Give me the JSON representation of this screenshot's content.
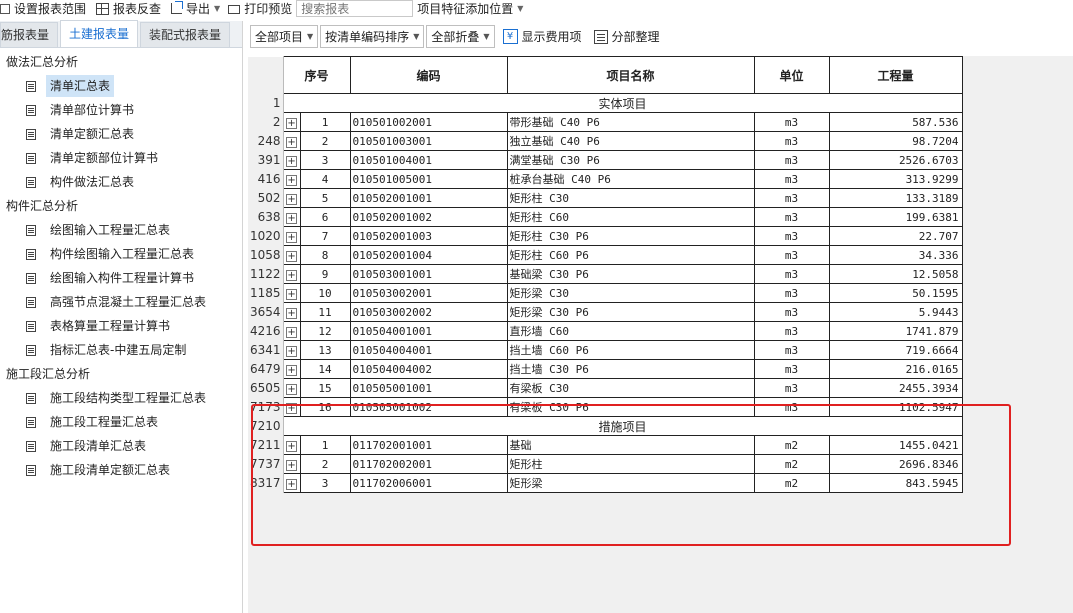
{
  "toolbar": {
    "set_range": "设置报表范围",
    "report_check": "报表反查",
    "export": "导出",
    "print_preview": "打印预览",
    "search_placeholder": "搜索报表",
    "feature_position": "项目特征添加位置"
  },
  "left_tabs": [
    "钢筋报表量",
    "土建报表量",
    "装配式报表量"
  ],
  "left_tabs_display": [
    "筋报表量",
    "土建报表量",
    "装配式报表量"
  ],
  "tree": {
    "group1": "做法汇总分析",
    "group1_items": [
      "清单汇总表",
      "清单部位计算书",
      "清单定额汇总表",
      "清单定额部位计算书",
      "构件做法汇总表"
    ],
    "group2": "构件汇总分析",
    "group2_items": [
      "绘图输入工程量汇总表",
      "构件绘图输入工程量汇总表",
      "绘图输入构件工程量计算书",
      "高强节点混凝土工程量汇总表",
      "表格算量工程量计算书",
      "指标汇总表-中建五局定制"
    ],
    "group3": "施工段汇总分析",
    "group3_items": [
      "施工段结构类型工程量汇总表",
      "施工段工程量汇总表",
      "施工段清单汇总表",
      "施工段清单定额汇总表"
    ]
  },
  "filters": {
    "all_items": "全部项目",
    "sort": "按清单编码排序",
    "fold": "全部折叠",
    "show_fee": "显示费用项",
    "section_sort": "分部整理"
  },
  "grid": {
    "headers": {
      "seq": "序号",
      "code": "编码",
      "name": "项目名称",
      "unit": "单位",
      "qty": "工程量"
    },
    "section1": {
      "row_no": "1",
      "title": "实体项目"
    },
    "rows1": [
      {
        "rn": "2",
        "seq": "1",
        "code": "010501002001",
        "name": "带形基础 C40 P6",
        "unit": "m3",
        "qty": "587.536"
      },
      {
        "rn": "248",
        "seq": "2",
        "code": "010501003001",
        "name": "独立基础 C40 P6",
        "unit": "m3",
        "qty": "98.7204"
      },
      {
        "rn": "391",
        "seq": "3",
        "code": "010501004001",
        "name": "满堂基础 C30 P6",
        "unit": "m3",
        "qty": "2526.6703"
      },
      {
        "rn": "416",
        "seq": "4",
        "code": "010501005001",
        "name": "桩承台基础 C40 P6",
        "unit": "m3",
        "qty": "313.9299"
      },
      {
        "rn": "502",
        "seq": "5",
        "code": "010502001001",
        "name": "矩形柱 C30",
        "unit": "m3",
        "qty": "133.3189"
      },
      {
        "rn": "638",
        "seq": "6",
        "code": "010502001002",
        "name": "矩形柱 C60",
        "unit": "m3",
        "qty": "199.6381"
      },
      {
        "rn": "1020",
        "seq": "7",
        "code": "010502001003",
        "name": "矩形柱 C30 P6",
        "unit": "m3",
        "qty": "22.707"
      },
      {
        "rn": "1058",
        "seq": "8",
        "code": "010502001004",
        "name": "矩形柱 C60 P6",
        "unit": "m3",
        "qty": "34.336"
      },
      {
        "rn": "1122",
        "seq": "9",
        "code": "010503001001",
        "name": "基础梁 C30 P6",
        "unit": "m3",
        "qty": "12.5058"
      },
      {
        "rn": "1185",
        "seq": "10",
        "code": "010503002001",
        "name": "矩形梁 C30",
        "unit": "m3",
        "qty": "50.1595"
      },
      {
        "rn": "3654",
        "seq": "11",
        "code": "010503002002",
        "name": "矩形梁 C30 P6",
        "unit": "m3",
        "qty": "5.9443"
      },
      {
        "rn": "4216",
        "seq": "12",
        "code": "010504001001",
        "name": "直形墙 C60",
        "unit": "m3",
        "qty": "1741.879"
      },
      {
        "rn": "6341",
        "seq": "13",
        "code": "010504004001",
        "name": "挡土墙 C60 P6",
        "unit": "m3",
        "qty": "719.6664"
      },
      {
        "rn": "6479",
        "seq": "14",
        "code": "010504004002",
        "name": "挡土墙 C30 P6",
        "unit": "m3",
        "qty": "216.0165"
      },
      {
        "rn": "6505",
        "seq": "15",
        "code": "010505001001",
        "name": "有梁板 C30",
        "unit": "m3",
        "qty": "2455.3934"
      },
      {
        "rn": "7173",
        "seq": "16",
        "code": "010505001002",
        "name": "有梁板 C30 P6",
        "unit": "m3",
        "qty": "1102.5947"
      }
    ],
    "section2": {
      "row_no": "7210",
      "title": "措施项目"
    },
    "rows2": [
      {
        "rn": "7211",
        "seq": "1",
        "code": "011702001001",
        "name": "基础",
        "unit": "m2",
        "qty": "1455.0421"
      },
      {
        "rn": "7737",
        "seq": "2",
        "code": "011702002001",
        "name": "矩形柱",
        "unit": "m2",
        "qty": "2696.8346"
      },
      {
        "rn": "8317",
        "seq": "3",
        "code": "011702006001",
        "name": "矩形梁",
        "unit": "m2",
        "qty": "843.5945"
      }
    ]
  },
  "colors": {
    "accent": "#1a6fd1",
    "highlight": "#e02020",
    "selected": "#cfe4f7"
  }
}
